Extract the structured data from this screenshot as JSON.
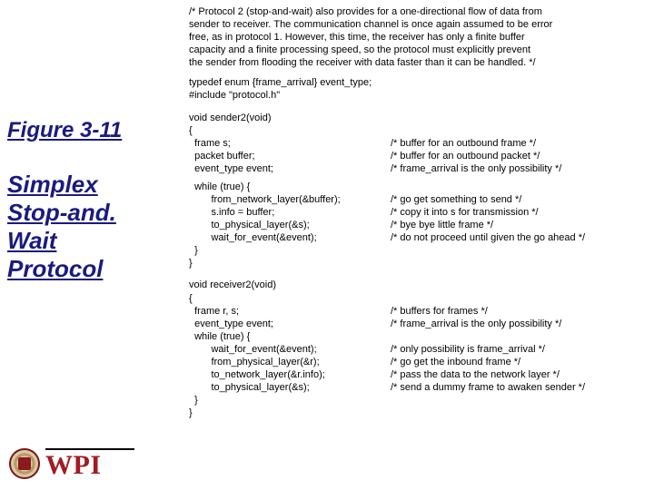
{
  "figure": {
    "number": "Figure 3-11",
    "title_lines": [
      "Simplex",
      "Stop-and.",
      "Wait",
      "Protocol"
    ]
  },
  "code": {
    "top_comment": [
      "/* Protocol 2 (stop-and-wait) also provides for a one-directional flow of data from",
      "sender to receiver. The communication channel is once again assumed to be error",
      "free, as in protocol 1. However, this time, the receiver has only a finite buffer",
      "capacity and a finite processing speed, so the protocol must explicitly prevent",
      "the sender from flooding the receiver with data faster than it can be handled. */"
    ],
    "decls": [
      "typedef enum {frame_arrival} event_type;",
      "#include \"protocol.h\""
    ],
    "sender": {
      "sig": "void sender2(void)",
      "open": "{",
      "vars": [
        {
          "l": "  frame s;",
          "c": "/* buffer for an outbound frame */"
        },
        {
          "l": "  packet buffer;",
          "c": "/* buffer for an outbound packet */"
        },
        {
          "l": "  event_type event;",
          "c": "/* frame_arrival is the only possibility */"
        }
      ],
      "loop_open": "  while (true) {",
      "loop_body": [
        {
          "l": "        from_network_layer(&buffer);",
          "c": "/* go get something to send */"
        },
        {
          "l": "        s.info = buffer;",
          "c": "/* copy it into s for transmission */"
        },
        {
          "l": "        to_physical_layer(&s);",
          "c": "/* bye bye little frame */"
        },
        {
          "l": "        wait_for_event(&event);",
          "c": "/* do not proceed until given the go ahead */"
        }
      ],
      "loop_close": "  }",
      "close": "}"
    },
    "receiver": {
      "sig": "void receiver2(void)",
      "open": "{",
      "vars": [
        {
          "l": "  frame r, s;",
          "c": "/* buffers for frames */"
        },
        {
          "l": "  event_type event;",
          "c": "/* frame_arrival is the only possibility */"
        }
      ],
      "loop_open": "  while (true) {",
      "loop_body": [
        {
          "l": "        wait_for_event(&event);",
          "c": "/* only possibility is frame_arrival */"
        },
        {
          "l": "        from_physical_layer(&r);",
          "c": "/* go get the inbound frame */"
        },
        {
          "l": "        to_network_layer(&r.info);",
          "c": "/* pass the data to the network layer */"
        },
        {
          "l": "        to_physical_layer(&s);",
          "c": "/* send a dummy frame to awaken sender */"
        }
      ],
      "loop_close": "  }",
      "close": "}"
    }
  },
  "logo": {
    "wordmark": "WPI"
  }
}
